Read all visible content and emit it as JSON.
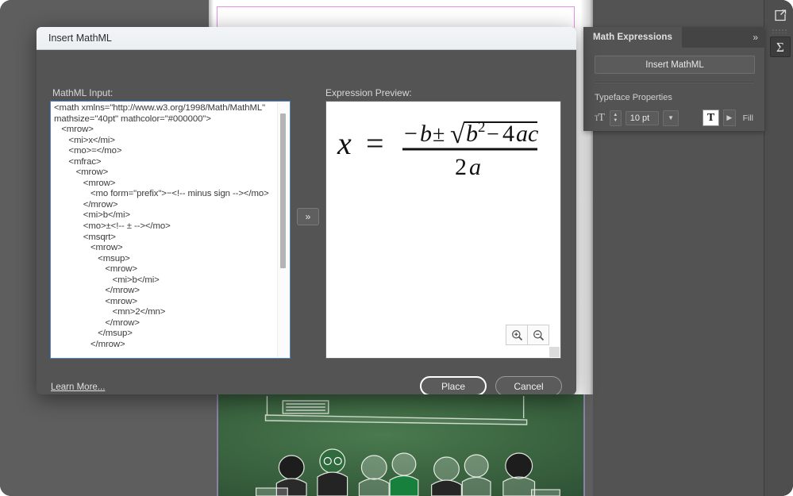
{
  "dialog": {
    "title": "Insert MathML",
    "input_label": "MathML Input:",
    "preview_label": "Expression Preview:",
    "mathml_value": "<math xmlns=\"http://www.w3.org/1998/Math/MathML\" mathsize=\"40pt\" mathcolor=\"#000000\">\n   <mrow>\n      <mi>x</mi>\n      <mo>=</mo>\n      <mfrac>\n         <mrow>\n            <mrow>\n               <mo form=\"prefix\">−<!-- minus sign --></mo>\n            </mrow>\n            <mi>b</mi>\n            <mo>±<!-- ± --></mo>\n            <msqrt>\n               <mrow>\n                  <msup>\n                     <mrow>\n                        <mi>b</mi>\n                     </mrow>\n                     <mrow>\n                        <mn>2</mn>\n                     </mrow>\n                  </msup>\n               </mrow>",
    "transfer_button": "»",
    "learn_more": "Learn More...",
    "place_button": "Place",
    "cancel_button": "Cancel",
    "zoom_in_icon": "zoom-in-icon",
    "zoom_out_icon": "zoom-out-icon",
    "formula": {
      "variable": "x",
      "equals": "=",
      "numerator": "−b±√(b²−4ac)",
      "denominator": "2a",
      "radicand": "b² − 4ac",
      "color": "#111111"
    }
  },
  "panel": {
    "tab_label": "Math Expressions",
    "collapse_icon": "»",
    "insert_button": "Insert MathML",
    "section_title": "Typeface Properties",
    "font_size_value": "10 pt",
    "font_size_icon": "text-size-icon",
    "stepper_icon": "stepper-updown-icon",
    "dropdown_icon": "chevron-down-icon",
    "fill_swatch_glyph": "T",
    "fill_arrow_icon": "chevron-right-icon",
    "fill_label": "Fill"
  },
  "dock": {
    "export_icon": "export-icon",
    "math_icon": "sigma-icon",
    "grip_icon": "grip-dots-icon"
  },
  "document": {
    "bleed_color": "#e58fe5",
    "board_color": "#3c6641",
    "spine_color": "#8e7fa8"
  }
}
